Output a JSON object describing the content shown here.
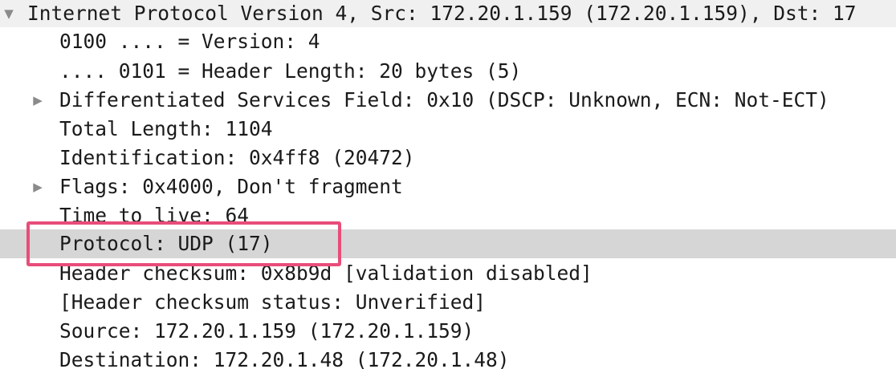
{
  "packet_details": {
    "ip_header": {
      "label": "Internet Protocol Version 4, Src: 172.20.1.159 (172.20.1.159), Dst: 17",
      "expanded": true,
      "toggle_glyph": "▼"
    },
    "fields": [
      {
        "label": "0100 .... = Version: 4",
        "expandable": false
      },
      {
        "label": ".... 0101 = Header Length: 20 bytes (5)",
        "expandable": false
      },
      {
        "label": "Differentiated Services Field: 0x10 (DSCP: Unknown, ECN: Not-ECT)",
        "expandable": true,
        "toggle_glyph": "▶"
      },
      {
        "label": "Total Length: 1104",
        "expandable": false
      },
      {
        "label": "Identification: 0x4ff8 (20472)",
        "expandable": false
      },
      {
        "label": "Flags: 0x4000, Don't fragment",
        "expandable": true,
        "toggle_glyph": "▶"
      },
      {
        "label": "Time to live: 64",
        "expandable": false
      },
      {
        "label": "Protocol: UDP (17)",
        "expandable": false,
        "selected": true
      },
      {
        "label": "Header checksum: 0x8b9d [validation disabled]",
        "expandable": false
      },
      {
        "label": "[Header checksum status: Unverified]",
        "expandable": false
      },
      {
        "label": "Source: 172.20.1.159 (172.20.1.159)",
        "expandable": false
      },
      {
        "label": "Destination: 172.20.1.48 (172.20.1.48)",
        "expandable": false
      }
    ]
  },
  "colors": {
    "selected_row": "#d6d6d6",
    "annotation": "#e84d7a"
  }
}
